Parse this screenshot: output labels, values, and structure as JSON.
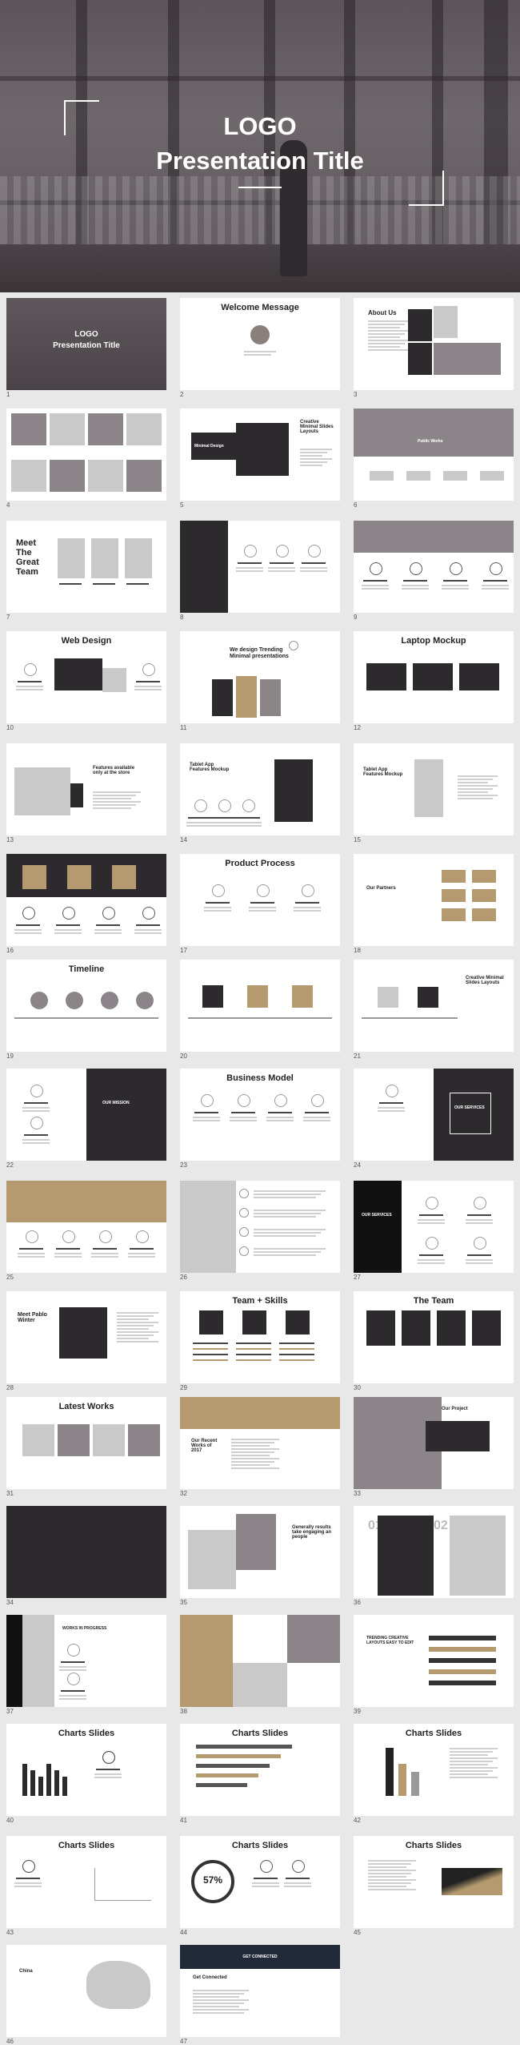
{
  "hero": {
    "logo": "LOGO",
    "title": "Presentation Title"
  },
  "thumbs": [
    {
      "n": "1",
      "title": "",
      "logo": "LOGO",
      "sub": "Presentation Title"
    },
    {
      "n": "2",
      "title": "Welcome Message"
    },
    {
      "n": "3",
      "title": "",
      "side": "About Us"
    },
    {
      "n": "4",
      "title": ""
    },
    {
      "n": "5",
      "title": "",
      "side": "Creative Minimal Slides Layouts",
      "box": "Minimal Design"
    },
    {
      "n": "6",
      "title": "",
      "side": "Public Works"
    },
    {
      "n": "7",
      "title": "",
      "side": "Meet The Great Team"
    },
    {
      "n": "8",
      "title": ""
    },
    {
      "n": "9",
      "title": ""
    },
    {
      "n": "10",
      "title": "Web Design"
    },
    {
      "n": "11",
      "title": "",
      "side": "We design Trending Minimal presentations"
    },
    {
      "n": "12",
      "title": "Laptop Mockup"
    },
    {
      "n": "13",
      "title": "",
      "side": "Features available only at the store"
    },
    {
      "n": "14",
      "title": "",
      "side": "Tablet App Features Mockup"
    },
    {
      "n": "15",
      "title": "",
      "side": "Tablet App Features Mockup"
    },
    {
      "n": "16",
      "title": ""
    },
    {
      "n": "17",
      "title": "Product Process"
    },
    {
      "n": "18",
      "title": "",
      "side": "Our Partners"
    },
    {
      "n": "19",
      "title": "Timeline"
    },
    {
      "n": "20",
      "title": ""
    },
    {
      "n": "21",
      "title": "",
      "side": "Creative Minimal Slides Layouts"
    },
    {
      "n": "22",
      "title": "",
      "box": "OUR MISSION"
    },
    {
      "n": "23",
      "title": "Business Model"
    },
    {
      "n": "24",
      "title": "",
      "box": "OUR SERVICES"
    },
    {
      "n": "25",
      "title": ""
    },
    {
      "n": "26",
      "title": ""
    },
    {
      "n": "27",
      "title": "",
      "box": "OUR SERVICES"
    },
    {
      "n": "28",
      "title": "",
      "side": "Meet Pablo Winter"
    },
    {
      "n": "29",
      "title": "Team + Skills"
    },
    {
      "n": "30",
      "title": "The Team"
    },
    {
      "n": "31",
      "title": "Latest Works"
    },
    {
      "n": "32",
      "title": "",
      "side": "Our Recent Works of 2017"
    },
    {
      "n": "33",
      "title": "",
      "box": "Our Project"
    },
    {
      "n": "34",
      "title": ""
    },
    {
      "n": "35",
      "title": "",
      "side": "Generally results take engaging an people"
    },
    {
      "n": "36",
      "title": "",
      "big1": "01",
      "big2": "02"
    },
    {
      "n": "37",
      "title": "",
      "side": "WORKS IN PROGRESS"
    },
    {
      "n": "38",
      "title": ""
    },
    {
      "n": "39",
      "title": "",
      "side": "TRENDING CREATIVE LAYOUTS EASY TO EDIT"
    },
    {
      "n": "40",
      "title": "Charts Slides"
    },
    {
      "n": "41",
      "title": "Charts Slides"
    },
    {
      "n": "42",
      "title": "Charts Slides"
    },
    {
      "n": "43",
      "title": "Charts Slides"
    },
    {
      "n": "44",
      "title": "Charts Slides",
      "pct": "57%"
    },
    {
      "n": "45",
      "title": "Charts Slides"
    },
    {
      "n": "46",
      "title": "",
      "side": "China"
    },
    {
      "n": "47",
      "title": "",
      "side": "Get Connected",
      "banner": "GET CONNECTED"
    }
  ]
}
